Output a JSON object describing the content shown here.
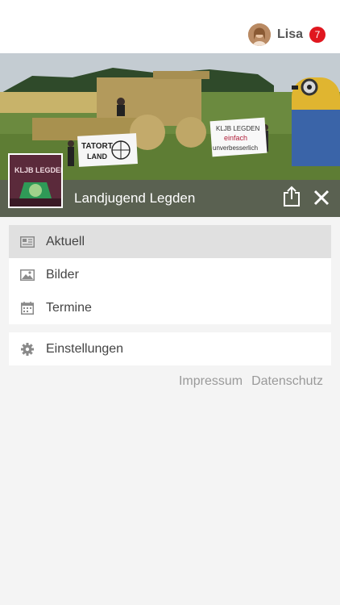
{
  "header": {
    "user_name": "Lisa",
    "notification_count": "7"
  },
  "group": {
    "name": "Landjugend Legden",
    "logo_text": "KLJB LEGDEN",
    "banner_left_text": "TATORT LAND",
    "banner_right_lines": [
      "KLJB LEGDEN",
      "einfach",
      "unverbesserlich"
    ]
  },
  "menu": {
    "items": [
      {
        "label": "Aktuell",
        "icon": "news-icon",
        "active": true
      },
      {
        "label": "Bilder",
        "icon": "image-icon",
        "active": false
      },
      {
        "label": "Termine",
        "icon": "calendar-icon",
        "active": false
      }
    ],
    "settings_label": "Einstellungen"
  },
  "footer": {
    "impressum": "Impressum",
    "datenschutz": "Datenschutz"
  },
  "colors": {
    "badge": "#e0171f",
    "active_item": "#e0e0e0"
  }
}
